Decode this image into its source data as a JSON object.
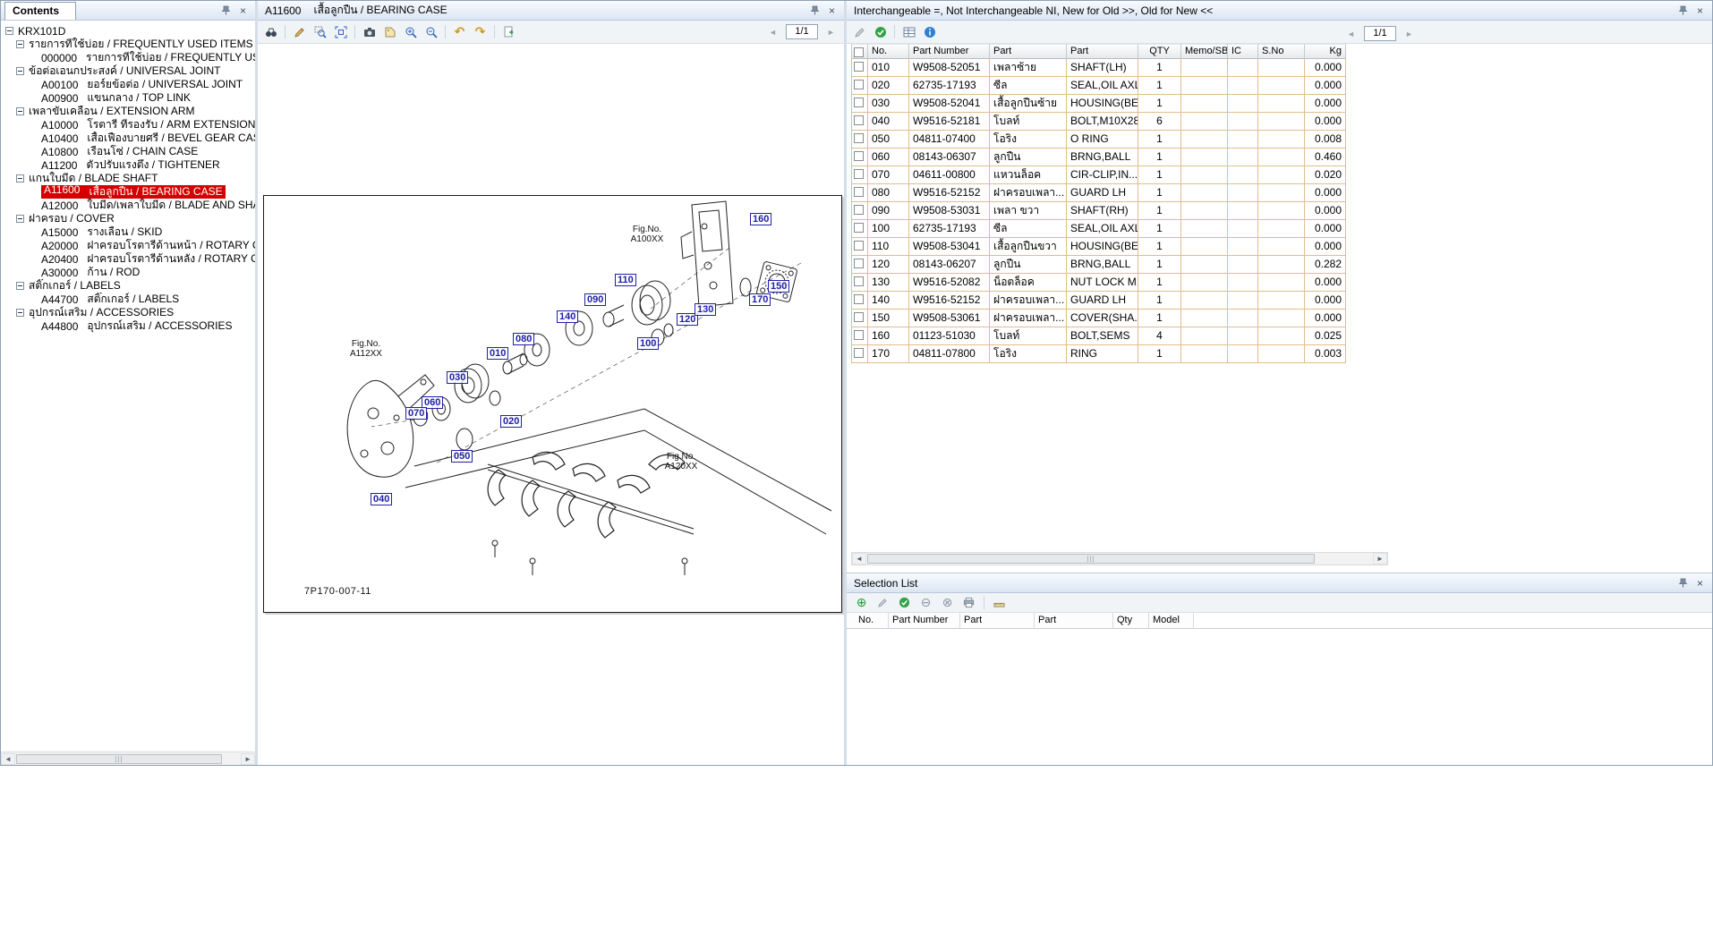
{
  "colors": {
    "accent": "#d40000",
    "callout": "#2020a8",
    "gridline": "#e0bd8c"
  },
  "icons": {
    "close": "×",
    "left_arrow": "◄",
    "right_arrow": "►",
    "up_arrow": "▲",
    "down_arrow": "▼",
    "undo": "↶",
    "redo": "↷",
    "check": "✓",
    "add": "⊕",
    "remove": "⊖",
    "clear": "⊗",
    "grip": "|||"
  },
  "contents": {
    "tab_title": "Contents",
    "root": "KRX101D",
    "nodes": [
      {
        "type": "group",
        "label": "รายการที่ใช้บ่อย / FREQUENTLY USED ITEMS"
      },
      {
        "type": "leaf",
        "code": "000000",
        "label": "รายการที่ใช้บ่อย / FREQUENTLY USED ITEMS"
      },
      {
        "type": "group",
        "label": "ข้อต่อเอนกประสงค์ / UNIVERSAL JOINT"
      },
      {
        "type": "leaf",
        "code": "A00100",
        "label": "ยอร์ยข้อต่อ / UNIVERSAL JOINT"
      },
      {
        "type": "leaf",
        "code": "A00900",
        "label": "แขนกลาง / TOP LINK"
      },
      {
        "type": "group",
        "label": "เพลาขับเคลื่อน / EXTENSION ARM"
      },
      {
        "type": "leaf",
        "code": "A10000",
        "label": "โรตารี่ ที่รองรับ / ARM EXTENSION"
      },
      {
        "type": "leaf",
        "code": "A10400",
        "label": "เสื้อเฟืองบายศรี / BEVEL GEAR CASE"
      },
      {
        "type": "leaf",
        "code": "A10800",
        "label": "เรือนโซ่ / CHAIN CASE"
      },
      {
        "type": "leaf",
        "code": "A11200",
        "label": "ตัวปรับแรงตึง / TIGHTENER"
      },
      {
        "type": "group",
        "label": "แกนใบมีด / BLADE SHAFT"
      },
      {
        "type": "leaf",
        "code": "A11600",
        "label": "เสื้อลูกปืน / BEARING CASE",
        "selected": true
      },
      {
        "type": "leaf",
        "code": "A12000",
        "label": "ใบมีด/เพลาใบมีด / BLADE AND SHAFT"
      },
      {
        "type": "group",
        "label": "ฝาครอบ / COVER"
      },
      {
        "type": "leaf",
        "code": "A15000",
        "label": "รางเลื่อน / SKID"
      },
      {
        "type": "leaf",
        "code": "A20000",
        "label": "ฝาครอบโรตารี่ด้านหน้า / ROTARY COVER"
      },
      {
        "type": "leaf",
        "code": "A20400",
        "label": "ฝาครอบโรตารี่ด้านหลัง / ROTARY COVER"
      },
      {
        "type": "leaf",
        "code": "A30000",
        "label": "ก้าน / ROD"
      },
      {
        "type": "group",
        "label": "สติ๊กเกอร์ / LABELS"
      },
      {
        "type": "leaf",
        "code": "A44700",
        "label": "สติ๊กเกอร์ / LABELS"
      },
      {
        "type": "group",
        "label": "อุปกรณ์เสริม / ACCESSORIES"
      },
      {
        "type": "leaf",
        "code": "A44800",
        "label": "อุปกรณ์เสริม / ACCESSORIES"
      }
    ]
  },
  "diagram": {
    "title_code": "A11600",
    "title_name": "เสื้อลูกปืน / BEARING CASE",
    "page_indicator": "1/1",
    "callouts": [
      "010",
      "020",
      "030",
      "040",
      "050",
      "060",
      "070",
      "080",
      "090",
      "100",
      "110",
      "120",
      "130",
      "140",
      "150",
      "160",
      "170"
    ],
    "fig_labels": [
      "Fig.No.\nA100XX",
      "Fig.No.\nA112XX",
      "Fig.No.\nA120XX"
    ],
    "drawing_number": "7P170-007-11"
  },
  "parts": {
    "title": "Interchangeable =, Not Interchangeable NI, New for Old >>, Old for New <<",
    "page_indicator": "1/1",
    "columns": [
      "No.",
      "Part Number",
      "Part",
      "Part",
      "QTY",
      "Memo/SB",
      "IC",
      "S.No",
      "Kg"
    ],
    "rows": [
      {
        "no": "010",
        "part_number": "W9508-52051",
        "part_local": "เพลาซ้าย",
        "part_en": "SHAFT(LH)",
        "qty": "1",
        "kg": "0.000"
      },
      {
        "no": "020",
        "part_number": "62735-17193",
        "part_local": "ซีล",
        "part_en": "SEAL,OIL AXLE",
        "qty": "1",
        "kg": "0.000"
      },
      {
        "no": "030",
        "part_number": "W9508-52041",
        "part_local": "เสื้อลูกปืนซ้าย",
        "part_en": "HOUSING(BE...",
        "qty": "1",
        "kg": "0.000"
      },
      {
        "no": "040",
        "part_number": "W9516-52181",
        "part_local": "โบลท์",
        "part_en": "BOLT,M10X28",
        "qty": "6",
        "kg": "0.000"
      },
      {
        "no": "050",
        "part_number": "04811-07400",
        "part_local": "โอริง",
        "part_en": "O RING",
        "qty": "1",
        "kg": "0.008"
      },
      {
        "no": "060",
        "part_number": "08143-06307",
        "part_local": "ลูกปืน",
        "part_en": "BRNG,BALL",
        "qty": "1",
        "kg": "0.460"
      },
      {
        "no": "070",
        "part_number": "04611-00800",
        "part_local": "แหวนล็อค",
        "part_en": "CIR-CLIP,IN...",
        "qty": "1",
        "kg": "0.020"
      },
      {
        "no": "080",
        "part_number": "W9516-52152",
        "part_local": "ฝาครอบเพลา...",
        "part_en": "GUARD LH",
        "qty": "1",
        "kg": "0.000"
      },
      {
        "no": "090",
        "part_number": "W9508-53031",
        "part_local": "เพลา ขวา",
        "part_en": "SHAFT(RH)",
        "qty": "1",
        "kg": "0.000"
      },
      {
        "no": "100",
        "part_number": "62735-17193",
        "part_local": "ซีล",
        "part_en": "SEAL,OIL AXLE",
        "qty": "1",
        "kg": "0.000"
      },
      {
        "no": "110",
        "part_number": "W9508-53041",
        "part_local": "เสื้อลูกปืนขวา",
        "part_en": "HOUSING(BE...",
        "qty": "1",
        "kg": "0.000"
      },
      {
        "no": "120",
        "part_number": "08143-06207",
        "part_local": "ลูกปืน",
        "part_en": "BRNG,BALL",
        "qty": "1",
        "kg": "0.282"
      },
      {
        "no": "130",
        "part_number": "W9516-52082",
        "part_local": "น็อตล็อค",
        "part_en": "NUT LOCK M...",
        "qty": "1",
        "kg": "0.000"
      },
      {
        "no": "140",
        "part_number": "W9516-52152",
        "part_local": "ฝาครอบเพลา...",
        "part_en": "GUARD LH",
        "qty": "1",
        "kg": "0.000"
      },
      {
        "no": "150",
        "part_number": "W9508-53061",
        "part_local": "ฝาครอบเพลา...",
        "part_en": "COVER(SHA...",
        "qty": "1",
        "kg": "0.000"
      },
      {
        "no": "160",
        "part_number": "01123-51030",
        "part_local": "โบลท์",
        "part_en": "BOLT,SEMS",
        "qty": "4",
        "kg": "0.025"
      },
      {
        "no": "170",
        "part_number": "04811-07800",
        "part_local": "โอริง",
        "part_en": "RING",
        "qty": "1",
        "kg": "0.003"
      }
    ]
  },
  "selection_list": {
    "title": "Selection List",
    "columns": [
      "No.",
      "Part Number",
      "Part",
      "Part",
      "Qty",
      "Model"
    ]
  }
}
